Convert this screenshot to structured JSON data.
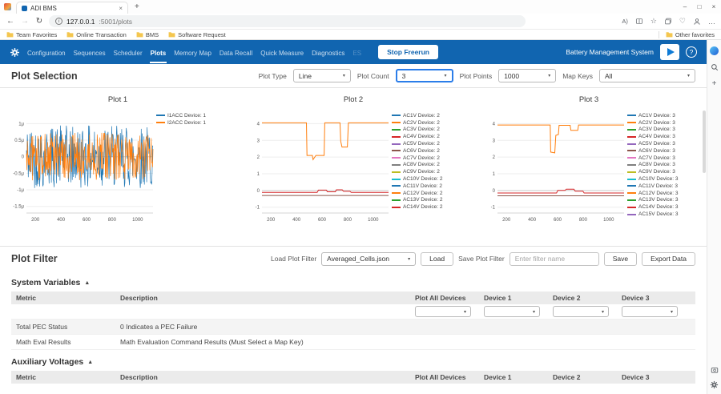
{
  "browser": {
    "tab_title": "ADI BMS",
    "url_host": "127.0.0.1",
    "url_path": ":5001/plots",
    "favorites": [
      "Team Favorites",
      "Online Transaction",
      "BMS",
      "Software Request"
    ],
    "other_favorites": "Other favorites"
  },
  "icons": {
    "back": "←",
    "forward": "→",
    "refresh": "↻",
    "info": "i",
    "minimize": "–",
    "maximize": "□",
    "close": "×",
    "tab_close": "×",
    "new_tab": "+",
    "caret": "▾",
    "collapse": "▲",
    "star": "☆",
    "heart": "♡",
    "ellipsis": "…",
    "read_aloud": "A)",
    "plus": "+"
  },
  "app": {
    "accent": "#1165b0",
    "nav_items": [
      {
        "label": "Configuration"
      },
      {
        "label": "Sequences"
      },
      {
        "label": "Scheduler"
      },
      {
        "label": "Plots",
        "active": true
      },
      {
        "label": "Memory Map"
      },
      {
        "label": "Data Recall"
      },
      {
        "label": "Quick Measure"
      },
      {
        "label": "Diagnostics"
      },
      {
        "label": "ES",
        "faint": true
      }
    ],
    "stop_button": "Stop Freerun",
    "brand": "Battery Management System"
  },
  "plot_selection": {
    "title": "Plot Selection",
    "controls": [
      {
        "label": "Plot Type",
        "value": "Line"
      },
      {
        "label": "Plot Count",
        "value": "3",
        "focused": true
      },
      {
        "label": "Plot Points",
        "value": "1000"
      },
      {
        "label": "Map Keys",
        "value": "All"
      }
    ]
  },
  "palette": [
    "#1f77b4",
    "#ff7f0e",
    "#2ca02c",
    "#d62728",
    "#9467bd",
    "#8c564b",
    "#e377c2",
    "#7f7f7f",
    "#bcbd22",
    "#17becf"
  ],
  "chart_data": [
    {
      "type": "line",
      "title": "Plot 1",
      "x_ticks": [
        200,
        400,
        600,
        800,
        1000
      ],
      "x_range": [
        130,
        1120
      ],
      "y_ticks": [
        {
          "v": 1,
          "t": "1μ"
        },
        {
          "v": 0.5,
          "t": "0.5μ"
        },
        {
          "v": 0,
          "t": "0"
        },
        {
          "v": -0.5,
          "t": "-0.5μ"
        },
        {
          "v": -1,
          "t": "-1μ"
        },
        {
          "v": -1.5,
          "t": "-1.5μ"
        }
      ],
      "y_range": [
        -1.7,
        1.25
      ],
      "ylabel": "",
      "xlabel": "",
      "legend": [
        "I1ACC Device: 1",
        "I2ACC Device: 1"
      ],
      "series": [
        {
          "legend": 0,
          "noise": {
            "seed": 42,
            "center": 0,
            "amp": 0.95,
            "n": 280
          }
        },
        {
          "legend": 1,
          "noise": {
            "seed": 97,
            "center": 0,
            "amp": 0.72,
            "n": 280
          }
        }
      ]
    },
    {
      "type": "line",
      "title": "Plot 2",
      "x_ticks": [
        200,
        400,
        600,
        800,
        1000
      ],
      "x_range": [
        130,
        1120
      ],
      "y_ticks": [
        {
          "v": 4,
          "t": "4"
        },
        {
          "v": 3,
          "t": "3"
        },
        {
          "v": 2,
          "t": "2"
        },
        {
          "v": 1,
          "t": "1"
        },
        {
          "v": 0,
          "t": "0"
        },
        {
          "v": -1,
          "t": "-1"
        }
      ],
      "y_range": [
        -1.35,
        4.5
      ],
      "ylabel": "",
      "xlabel": "",
      "legend": [
        "AC1V Device: 2",
        "AC2V Device: 2",
        "AC3V Device: 2",
        "AC4V Device: 2",
        "AC5V Device: 2",
        "AC6V Device: 2",
        "AC7V Device: 2",
        "AC8V Device: 2",
        "AC9V Device: 2",
        "AC10V Device: 2",
        "AC11V Device: 2",
        "AC12V Device: 2",
        "AC13V Device: 2",
        "AC14V Device: 2"
      ],
      "series": [
        {
          "legend": 5,
          "points": [
            [
              130,
              -0.3
            ],
            [
              1120,
              -0.3
            ]
          ]
        },
        {
          "legend": 3,
          "points": [
            [
              130,
              -0.12
            ],
            [
              562,
              -0.12
            ],
            [
              572,
              0.02
            ],
            [
              634,
              0.02
            ],
            [
              642,
              -0.08
            ],
            [
              704,
              -0.08
            ],
            [
              712,
              0.04
            ],
            [
              758,
              0.04
            ],
            [
              768,
              -0.05
            ],
            [
              818,
              -0.05
            ],
            [
              828,
              -0.12
            ],
            [
              1120,
              -0.12
            ]
          ]
        },
        {
          "legend": 1,
          "points": [
            [
              130,
              4.05
            ],
            [
              478,
              4.05
            ],
            [
              482,
              2.1
            ],
            [
              524,
              2.1
            ],
            [
              530,
              1.85
            ],
            [
              552,
              2.1
            ],
            [
              616,
              2.1
            ],
            [
              621,
              4.05
            ],
            [
              740,
              4.05
            ],
            [
              746,
              2.95
            ],
            [
              756,
              2.6
            ],
            [
              798,
              2.6
            ],
            [
              806,
              4.05
            ],
            [
              1120,
              4.05
            ]
          ]
        }
      ]
    },
    {
      "type": "line",
      "title": "Plot 3",
      "x_ticks": [
        200,
        400,
        600,
        800,
        1000
      ],
      "x_range": [
        130,
        1120
      ],
      "y_ticks": [
        {
          "v": 4,
          "t": "4"
        },
        {
          "v": 3,
          "t": "3"
        },
        {
          "v": 2,
          "t": "2"
        },
        {
          "v": 1,
          "t": "1"
        },
        {
          "v": 0,
          "t": "0"
        },
        {
          "v": -1,
          "t": "-1"
        }
      ],
      "y_range": [
        -1.35,
        4.5
      ],
      "ylabel": "",
      "xlabel": "",
      "legend": [
        "AC1V Device: 3",
        "AC2V Device: 3",
        "AC3V Device: 3",
        "AC4V Device: 3",
        "AC5V Device: 3",
        "AC6V Device: 3",
        "AC7V Device: 3",
        "AC8V Device: 3",
        "AC9V Device: 3",
        "AC10V Device: 3",
        "AC11V Device: 3",
        "AC12V Device: 3",
        "AC13V Device: 3",
        "AC14V Device: 3",
        "AC15V Device: 3"
      ],
      "series": [
        {
          "legend": 5,
          "points": [
            [
              130,
              -0.32
            ],
            [
              1120,
              -0.32
            ]
          ]
        },
        {
          "legend": 3,
          "points": [
            [
              130,
              -0.15
            ],
            [
              592,
              -0.15
            ],
            [
              602,
              0.0
            ],
            [
              658,
              0.0
            ],
            [
              668,
              0.08
            ],
            [
              728,
              0.08
            ],
            [
              738,
              -0.04
            ],
            [
              798,
              -0.04
            ],
            [
              808,
              -0.15
            ],
            [
              1120,
              -0.15
            ]
          ]
        },
        {
          "legend": 1,
          "points": [
            [
              130,
              3.92
            ],
            [
              542,
              3.92
            ],
            [
              546,
              2.3
            ],
            [
              578,
              2.25
            ],
            [
              586,
              3.3
            ],
            [
              606,
              3.35
            ],
            [
              612,
              3.9
            ],
            [
              698,
              3.9
            ],
            [
              704,
              3.6
            ],
            [
              758,
              3.6
            ],
            [
              764,
              3.92
            ],
            [
              1120,
              3.92
            ]
          ]
        }
      ]
    }
  ],
  "plot_filter": {
    "title": "Plot Filter",
    "load_label": "Load Plot Filter",
    "load_value": "Averaged_Cells.json",
    "load_button": "Load",
    "save_label": "Save Plot Filter",
    "save_placeholder": "Enter filter name",
    "save_button": "Save",
    "export_button": "Export Data"
  },
  "sections": [
    {
      "title": "System Variables",
      "columns": [
        "Metric",
        "Description",
        "Plot All Devices",
        "Device 1",
        "Device 2",
        "Device 3"
      ],
      "rows": [
        {
          "metric": "",
          "description": "",
          "has_selects": true
        },
        {
          "metric": "Total PEC Status",
          "description": "0 Indicates a PEC Failure",
          "has_selects": false
        },
        {
          "metric": "Math Eval Results",
          "description": "Math Evaluation Command Results (Must Select a Map Key)",
          "has_selects": false
        }
      ]
    },
    {
      "title": "Auxiliary Voltages",
      "columns": [
        "Metric",
        "Description",
        "Plot All Devices",
        "Device 1",
        "Device 2",
        "Device 3"
      ],
      "rows": []
    }
  ]
}
